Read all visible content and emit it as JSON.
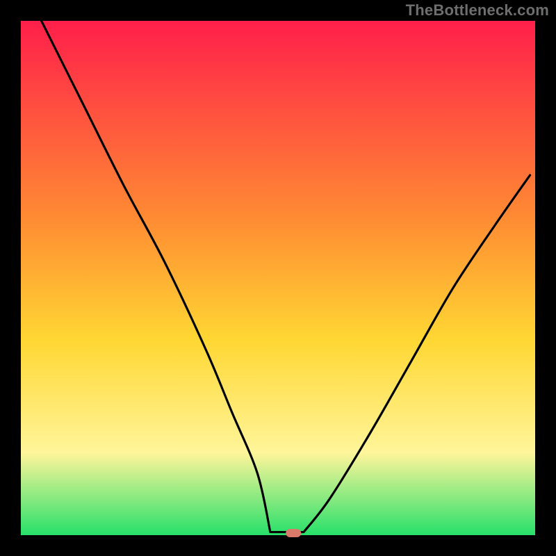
{
  "attribution": "TheBottleneck.com",
  "colors": {
    "top": "#ff1f4a",
    "mid1": "#ff8a33",
    "mid2": "#ffd733",
    "low1": "#fff59a",
    "base": "#27e06a",
    "bg": "#000000",
    "curve": "#000000",
    "marker": "#d97a6a"
  },
  "chart_data": {
    "type": "line",
    "title": "",
    "xlabel": "",
    "ylabel": "",
    "xlim": [
      0,
      100
    ],
    "ylim": [
      0,
      100
    ],
    "x": [
      4,
      12,
      20,
      28,
      36,
      41,
      46,
      49,
      51,
      53,
      55,
      60,
      68,
      76,
      84,
      92,
      99
    ],
    "values": [
      100,
      84,
      68,
      53,
      36,
      24,
      12,
      4,
      1,
      0,
      1,
      7,
      20,
      34,
      48,
      60,
      70
    ],
    "marker": {
      "x": 53,
      "y": 0
    },
    "plateau": {
      "x_start": 48.5,
      "x_end": 55,
      "y": 0.6
    }
  }
}
